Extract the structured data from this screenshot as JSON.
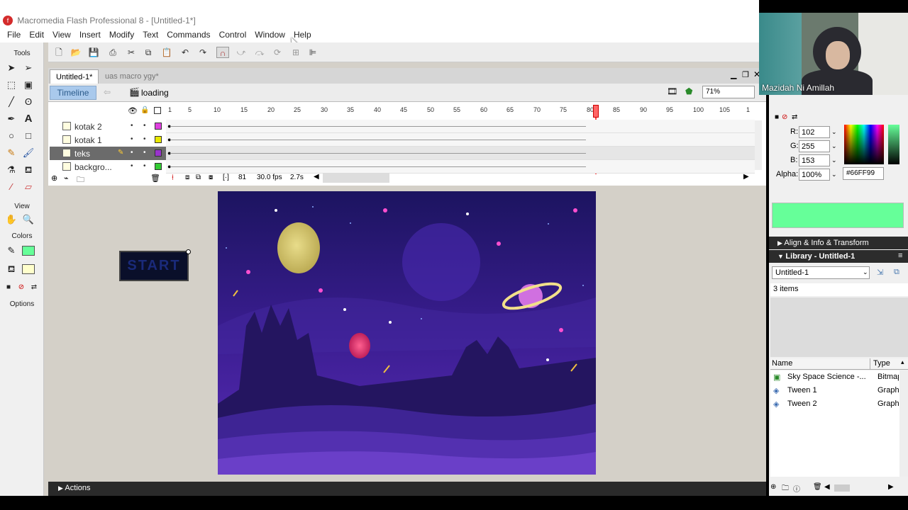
{
  "window": {
    "title": "Macromedia Flash Professional 8 - [Untitled-1*]"
  },
  "menu": [
    "File",
    "Edit",
    "View",
    "Insert",
    "Modify",
    "Text",
    "Commands",
    "Control",
    "Window",
    "Help"
  ],
  "tools": {
    "header": "Tools",
    "view_header": "View",
    "colors_header": "Colors",
    "options_header": "Options"
  },
  "doc_tabs": [
    {
      "label": "Untitled-1*"
    },
    {
      "label": "uas macro ygy*"
    }
  ],
  "timeline": {
    "button_label": "Timeline",
    "scene_label": "loading",
    "zoom": "71%",
    "layers": [
      {
        "name": "kotak 2",
        "color": "#e040e0"
      },
      {
        "name": "kotak 1",
        "color": "#e8e800"
      },
      {
        "name": "teks",
        "color": "#9933cc"
      },
      {
        "name": "backgro...",
        "color": "#33cc33"
      }
    ],
    "ruler": [
      "1",
      "5",
      "10",
      "15",
      "20",
      "25",
      "30",
      "35",
      "40",
      "45",
      "50",
      "55",
      "60",
      "65",
      "70",
      "75",
      "80",
      "85",
      "90",
      "95",
      "100",
      "105",
      "1"
    ],
    "current_frame": "81",
    "fps": "30.0 fps",
    "time": "2.7s"
  },
  "stage_object": {
    "text": "START"
  },
  "color_mixer": {
    "r": "102",
    "g": "255",
    "b": "153",
    "alpha": "100%",
    "hex": "#66FF99",
    "swatch_color": "#66ff99",
    "r_label": "R:",
    "g_label": "G:",
    "b_label": "B:",
    "alpha_label": "Alpha:"
  },
  "panels": {
    "align_label": "Align & Info & Transform",
    "library_label": "Library - Untitled-1",
    "library_select": "Untitled-1",
    "item_count": "3 items",
    "columns": [
      "Name",
      "Type"
    ],
    "items": [
      {
        "name": "Sky Space Science -...",
        "type": "Bitmap"
      },
      {
        "name": "Tween 1",
        "type": "Graph"
      },
      {
        "name": "Tween 2",
        "type": "Graph"
      }
    ]
  },
  "webcam": {
    "name": "Mazidah Ni Amillah"
  },
  "actions": {
    "label": "Actions"
  }
}
